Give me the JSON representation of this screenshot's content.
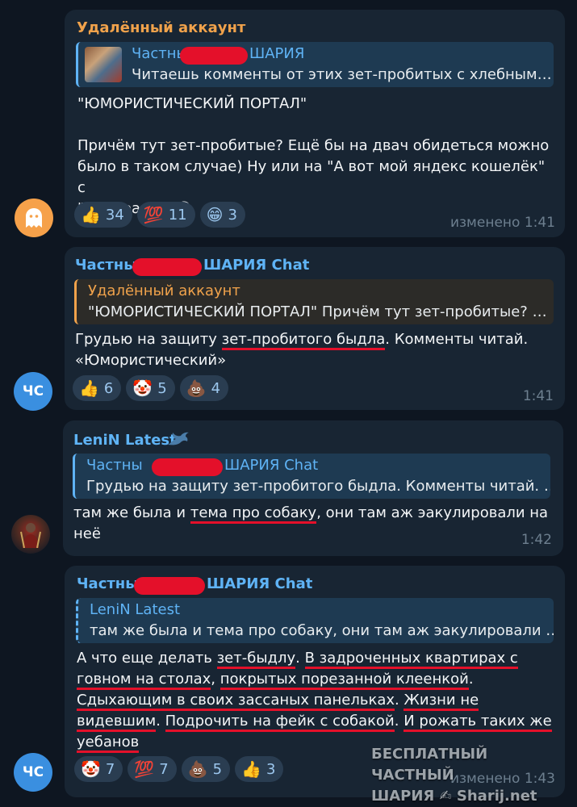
{
  "colors": {
    "background": "#0e1621",
    "bubble": "#182533",
    "accent_red": "#e4102a",
    "link_blue": "#5fb3f5",
    "deleted_orange": "#f0a24b",
    "reaction_count": "#9cc7ee",
    "time_gray": "#6d7f8f"
  },
  "messages": [
    {
      "sender": "Удалённый аккаунт",
      "reply": {
        "name_left": "Частны",
        "name_right": "ШАРИЯ",
        "text": "Читаешь комменты от этих зет-пробитых с хлебным…"
      },
      "lines": [
        "\"ЮМОРИСТИЧЕСКИЙ ПОРТАЛ\"",
        "Причём тут зет-пробитые? Ещё бы на двач обидеться можно",
        "было в таком случае) Ну или на \"А вот мой яндекс кошелёк\" с",
        "\"Панорамой\"😁"
      ],
      "reactions": [
        {
          "emoji": "👍",
          "count": "34"
        },
        {
          "emoji": "💯",
          "count": "11"
        },
        {
          "emoji": "😁",
          "count": "3"
        }
      ],
      "time": "изменено 1:41",
      "avatar_icon": "ghost-icon"
    },
    {
      "sender_left": "Частны",
      "sender_right": "ШАРИЯ Chat",
      "reply": {
        "name": "Удалённый аккаунт",
        "text": "\"ЮМОРИСТИЧЕСКИЙ ПОРТАЛ\"  Причём тут зет-пробитые? …"
      },
      "line1_a": "Грудью на защиту ",
      "line1_u": "зет-пробитого быдла",
      "line1_b": ". Комменты читай.",
      "line2": "«Юмористический»",
      "reactions": [
        {
          "emoji": "👍",
          "count": "6"
        },
        {
          "emoji": "🤡",
          "count": "5"
        },
        {
          "emoji": "💩",
          "count": "4"
        }
      ],
      "time": "1:41",
      "avatar_text": "ЧС"
    },
    {
      "sender": "LeniN Latest",
      "reply": {
        "name_left": "Частны",
        "name_right": "ШАРИЯ Chat",
        "text": "Грудью на защиту зет-пробитого быдла. Комменты читай. …"
      },
      "line1_a": "там же была и ",
      "line1_u": "тема про собаку",
      "line1_b": ", они там аж эакулировали на",
      "line2": "неё",
      "time": "1:42"
    },
    {
      "sender_left": "Частны",
      "sender_right": "ШАРИЯ Chat",
      "reply": {
        "name": "LeniN Latest",
        "text": "там же была и тема про собаку, они там аж эакулировали …"
      },
      "l1": [
        "А что еще делать ",
        "зет-быдлу",
        ". ",
        "В задроченных квартирах с"
      ],
      "l2": [
        "говном на столах",
        ", ",
        "покрытых порезанной клеенкой",
        "."
      ],
      "l3": [
        "Сдыхающим в своих зассаных панельках",
        ". ",
        "Жизни не"
      ],
      "l4": [
        "видевшим",
        ". ",
        "Подрочить на фейк с собакой",
        ". ",
        "И рожать таких же"
      ],
      "l5": [
        "уебанов"
      ],
      "reactions": [
        {
          "emoji": "🤡",
          "count": "7"
        },
        {
          "emoji": "💯",
          "count": "7"
        },
        {
          "emoji": "💩",
          "count": "5"
        },
        {
          "emoji": "👍",
          "count": "3"
        }
      ],
      "time": "изменено 1:43",
      "avatar_text": "ЧС"
    }
  ],
  "watermark": {
    "line1": "БЕСПЛАТНЫЙ ЧАСТНЫЙ",
    "line2": "ШАРИЯ ✍ Sharij.net"
  }
}
